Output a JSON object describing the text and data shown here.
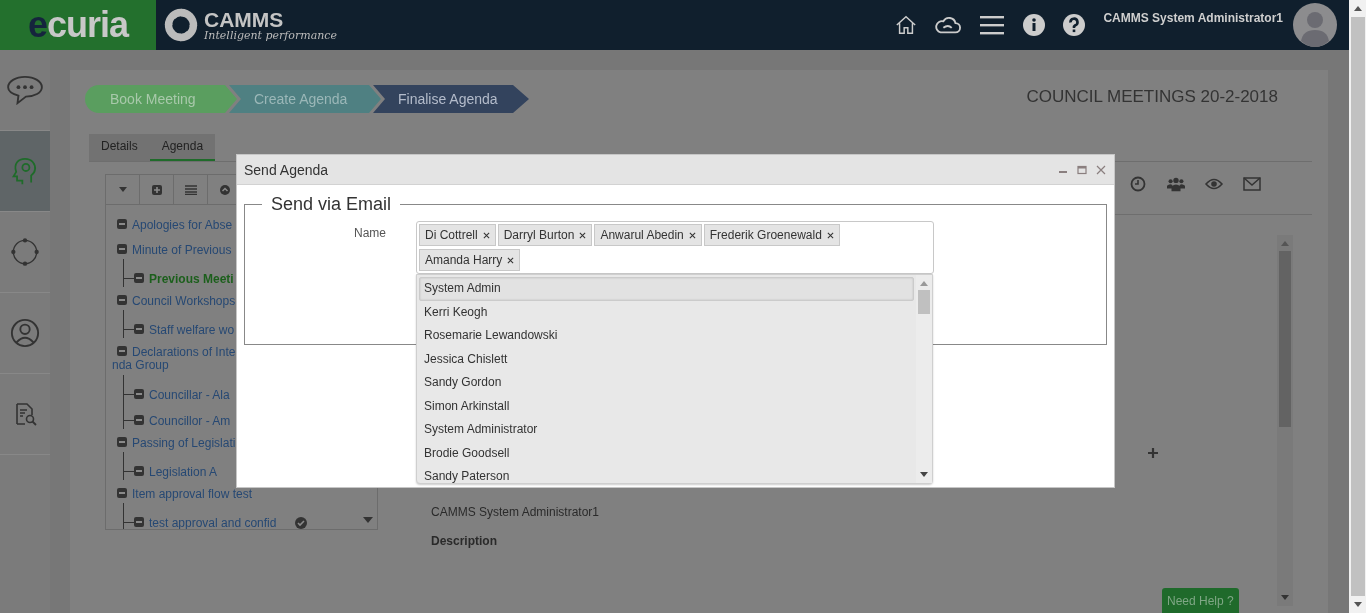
{
  "header": {
    "logo": {
      "first": "e",
      "rest": "curia"
    },
    "brand": {
      "name": "CAMMS",
      "tagline": "Intelligent performance"
    },
    "user": "CAMMS System Administrator1"
  },
  "sidebar": {
    "items": [
      {
        "kind": "chat",
        "selected": false
      },
      {
        "kind": "agent",
        "selected": true
      },
      {
        "kind": "cycle",
        "selected": false
      },
      {
        "kind": "user",
        "selected": false
      },
      {
        "kind": "report",
        "selected": false
      }
    ]
  },
  "steps": [
    {
      "label": "Book Meeting",
      "color": "#5a9e5f"
    },
    {
      "label": "Create Agenda",
      "color": "#4f8082"
    },
    {
      "label": "Finalise Agenda",
      "color": "#33435d"
    }
  ],
  "page_title": "COUNCIL MEETINGS 20-2-2018",
  "tabs": [
    {
      "label": "Details",
      "selected": false
    },
    {
      "label": "Agenda",
      "selected": true
    }
  ],
  "tree": {
    "items": [
      {
        "label": "Apologies for Abse",
        "selected": false
      },
      {
        "label": "Minute of Previous",
        "selected": false,
        "children": [
          {
            "label": "Previous Meeti",
            "selected": true
          }
        ]
      },
      {
        "label": "Council Workshops",
        "selected": false,
        "children": [
          {
            "label": "Staff welfare wo",
            "selected": false
          }
        ]
      },
      {
        "label": "Declarations of Inte",
        "label_continued": "nda Group",
        "selected": false,
        "children": [
          {
            "label": "Councillar - Ala",
            "selected": false
          },
          {
            "label": "Councillor - Am",
            "selected": false
          }
        ]
      },
      {
        "label": "Passing of Legislati",
        "selected": false,
        "children": [
          {
            "label": "Legislation A",
            "selected": false
          }
        ]
      },
      {
        "label": "Item approval flow test",
        "selected": false,
        "children": [
          {
            "label": "test approval and confid",
            "selected": false,
            "approved": true
          }
        ]
      }
    ]
  },
  "details": {
    "author": "CAMMS System Administrator1",
    "description_label": "Description"
  },
  "help_button": "Need Help ?",
  "dialog": {
    "title": "Send Agenda",
    "section": "Send via Email",
    "name_label": "Name",
    "recipients": [
      "Di Cottrell",
      "Darryl Burton",
      "Anwarul Abedin",
      "Frederik Groenewald",
      "Amanda Harry"
    ],
    "options": [
      {
        "label": "System Admin",
        "selected": true
      },
      {
        "label": "Kerri Keogh",
        "selected": false
      },
      {
        "label": "Rosemarie Lewandowski",
        "selected": false
      },
      {
        "label": "Jessica Chislett",
        "selected": false
      },
      {
        "label": "Sandy Gordon",
        "selected": false
      },
      {
        "label": "Simon Arkinstall",
        "selected": false
      },
      {
        "label": "System Administrator",
        "selected": false
      },
      {
        "label": "Brodie Goodsell",
        "selected": false
      },
      {
        "label": "Sandy Paterson",
        "selected": false
      }
    ]
  }
}
